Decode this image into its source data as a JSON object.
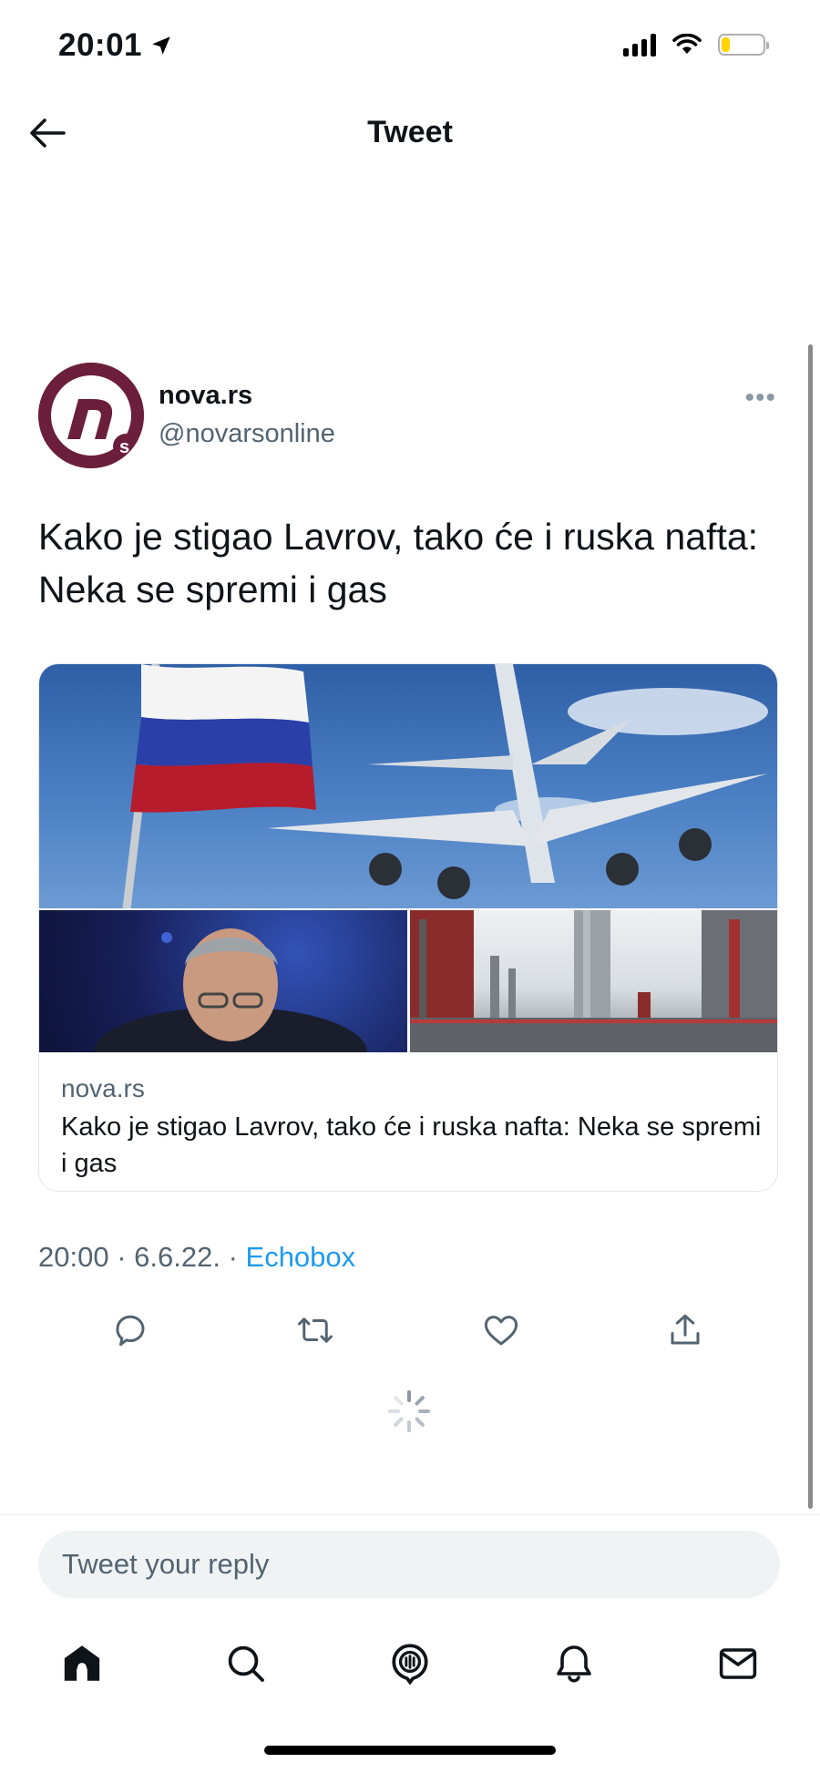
{
  "status_bar": {
    "time": "20:01",
    "battery_level": 0.2
  },
  "header": {
    "title": "Tweet"
  },
  "tweet": {
    "author_name": "nova.rs",
    "author_handle": "@novarsonline",
    "text": "Kako je stigao Lavrov, tako će i ruska nafta: Neka se spremi i gas",
    "more_label": "•••",
    "card": {
      "domain": "nova.rs",
      "title": "Kako je stigao Lavrov, tako će i ruska nafta: Neka se spremi i gas"
    },
    "meta": {
      "time": "20:00",
      "date": "6.6.22.",
      "source": "Echobox",
      "separator": " · "
    }
  },
  "reply": {
    "placeholder": "Tweet your reply"
  },
  "colors": {
    "accent": "#1d9bf0",
    "avatar": "#6b1f3a",
    "battery": "#ffd400"
  },
  "icons": {
    "actions": [
      "reply-icon",
      "retweet-icon",
      "like-icon",
      "share-icon"
    ],
    "tabs": [
      "home-icon",
      "search-icon",
      "spaces-icon",
      "notifications-icon",
      "messages-icon"
    ]
  }
}
